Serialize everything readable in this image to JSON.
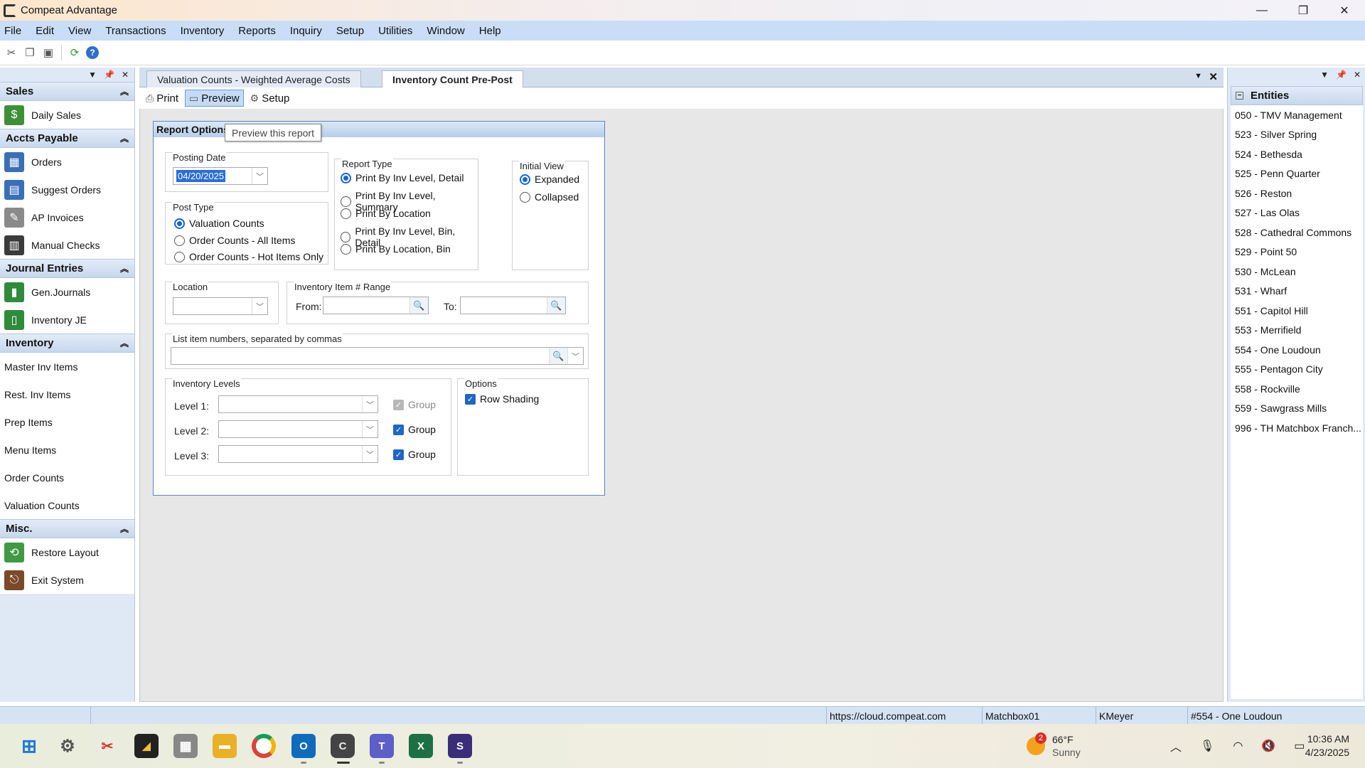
{
  "app": {
    "title": "Compeat Advantage"
  },
  "window_controls": {
    "minimize": "—",
    "restore": "❐",
    "close": "✕"
  },
  "menu": [
    "File",
    "Edit",
    "View",
    "Transactions",
    "Inventory",
    "Reports",
    "Inquiry",
    "Setup",
    "Utilities",
    "Window",
    "Help"
  ],
  "left_nav": {
    "groups": [
      {
        "label": "Sales",
        "items": [
          {
            "label": "Daily Sales",
            "icon": "cash-register-icon",
            "color": "#3f8f3a"
          }
        ]
      },
      {
        "label": "Accts Payable",
        "items": [
          {
            "label": "Orders",
            "icon": "orders-grid-icon",
            "color": "#3a6fb8"
          },
          {
            "label": "Suggest Orders",
            "icon": "suggest-orders-icon",
            "color": "#3a6fb8"
          },
          {
            "label": "AP Invoices",
            "icon": "invoice-icon",
            "color": "#8a8a8a"
          },
          {
            "label": "Manual Checks",
            "icon": "checks-icon",
            "color": "#3b3b3b"
          }
        ]
      },
      {
        "label": "Journal Entries",
        "items": [
          {
            "label": "Gen.Journals",
            "icon": "journal-icon",
            "color": "#2f8a3b"
          },
          {
            "label": "Inventory JE",
            "icon": "inventory-je-icon",
            "color": "#2f8a3b"
          }
        ]
      },
      {
        "label": "Inventory",
        "items": [
          {
            "label": "Master Inv Items"
          },
          {
            "label": "Rest. Inv Items"
          },
          {
            "label": "Prep Items"
          },
          {
            "label": "Menu Items"
          },
          {
            "label": "Order Counts"
          },
          {
            "label": "Valuation Counts"
          }
        ]
      },
      {
        "label": "Misc.",
        "items": [
          {
            "label": "Restore Layout",
            "icon": "restore-layout-icon",
            "color": "#3f9a43"
          },
          {
            "label": "Exit System",
            "icon": "exit-door-icon",
            "color": "#7a4a2a"
          }
        ]
      }
    ]
  },
  "tabs": [
    {
      "label": "Valuation Counts - Weighted Average Costs",
      "active": false
    },
    {
      "label": "Inventory Count Pre-Post",
      "active": true
    }
  ],
  "report_toolbar": {
    "print": "Print",
    "preview": "Preview",
    "setup": "Setup",
    "tooltip": "Preview this report"
  },
  "report_options": {
    "title": "Report Options",
    "posting_date": {
      "label": "Posting Date",
      "value": "04/20/2025"
    },
    "post_type": {
      "label": "Post Type",
      "options": [
        "Valuation Counts",
        "Order Counts - All Items",
        "Order Counts - Hot Items Only"
      ],
      "selected": 0
    },
    "report_type": {
      "label": "Report Type",
      "options": [
        "Print By Inv Level, Detail",
        "Print By Inv Level, Summary",
        "Print By Location",
        "Print By Inv Level, Bin, Detail",
        "Print By Location, Bin"
      ],
      "selected": 0
    },
    "initial_view": {
      "label": "Initial View",
      "options": [
        "Expanded",
        "Collapsed"
      ],
      "selected": 0
    },
    "location": {
      "label": "Location",
      "value": ""
    },
    "item_range": {
      "label": "Inventory Item # Range",
      "from_label": "From:",
      "to_label": "To:",
      "from": "",
      "to": ""
    },
    "list_items": {
      "label": "List item numbers, separated by commas",
      "value": ""
    },
    "inventory_levels": {
      "label": "Inventory Levels",
      "levels": [
        {
          "label": "Level 1:",
          "group_label": "Group",
          "group_checked": true,
          "group_enabled": false
        },
        {
          "label": "Level 2:",
          "group_label": "Group",
          "group_checked": true,
          "group_enabled": true
        },
        {
          "label": "Level 3:",
          "group_label": "Group",
          "group_checked": true,
          "group_enabled": true
        }
      ]
    },
    "options": {
      "label": "Options",
      "row_shading_label": "Row Shading",
      "row_shading": true
    }
  },
  "entities": {
    "title": "Entities",
    "items": [
      "050 - TMV Management",
      "523 - Silver Spring",
      "524 - Bethesda",
      "525 - Penn Quarter",
      "526 - Reston",
      "527 - Las Olas",
      "528 - Cathedral Commons",
      "529 - Point 50",
      "530 - McLean",
      "531 - Wharf",
      "551 - Capitol Hill",
      "553 - Merrifield",
      "554 - One Loudoun",
      "555 - Pentagon City",
      "558 - Rockville",
      "559 - Sawgrass Mills",
      "996 - TH Matchbox Franch..."
    ]
  },
  "status_bar": {
    "url": "https://cloud.compeat.com",
    "db": "Matchbox01",
    "user": "KMeyer",
    "entity": "#554 - One Loudoun"
  },
  "taskbar": {
    "weather": {
      "temp": "66°F",
      "cond": "Sunny",
      "badge": "2"
    },
    "time": "10:36 AM",
    "date": "4/23/2025"
  }
}
